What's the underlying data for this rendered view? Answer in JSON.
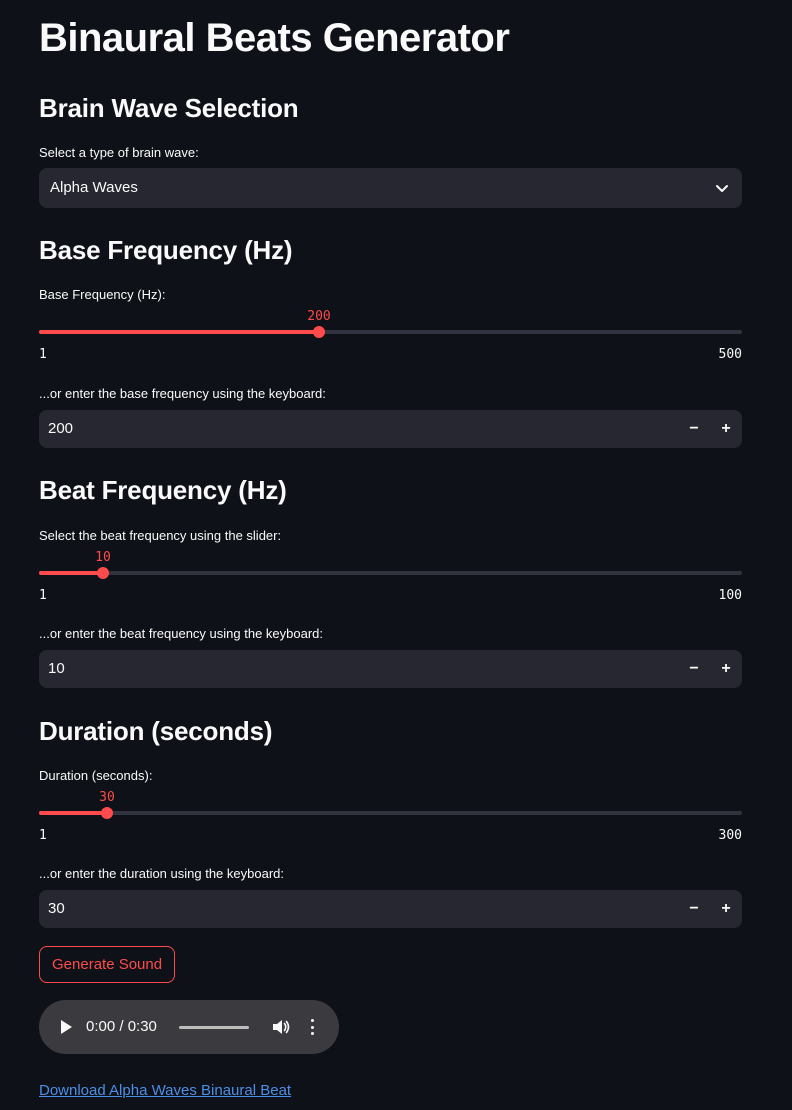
{
  "title": "Binaural Beats Generator",
  "brain_wave": {
    "heading": "Brain Wave Selection",
    "label": "Select a type of brain wave:",
    "selected": "Alpha Waves"
  },
  "base_frequency": {
    "heading": "Base Frequency (Hz)",
    "slider_label": "Base Frequency (Hz):",
    "slider_value": "200",
    "slider_min": "1",
    "slider_max": "500",
    "input_label": "...or enter the base frequency using the keyboard:",
    "input_value": "200"
  },
  "beat_frequency": {
    "heading": "Beat Frequency (Hz)",
    "slider_label": "Select the beat frequency using the slider:",
    "slider_value": "10",
    "slider_min": "1",
    "slider_max": "100",
    "input_label": "...or enter the beat frequency using the keyboard:",
    "input_value": "10"
  },
  "duration": {
    "heading": "Duration (seconds)",
    "slider_label": "Duration (seconds):",
    "slider_value": "30",
    "slider_min": "1",
    "slider_max": "300",
    "input_label": "...or enter the duration using the keyboard:",
    "input_value": "30"
  },
  "steppers": {
    "minus": "−",
    "plus": "+"
  },
  "generate_button": "Generate Sound",
  "audio_player": {
    "time": "0:00 / 0:30"
  },
  "download_link": "Download Alpha Waves Binaural Beat",
  "colors": {
    "background": "#0e1117",
    "accent": "#ff4b4b",
    "input_bg": "#262730",
    "link": "#4d8ee8"
  },
  "icons": {
    "select": "chevron-down-icon",
    "play": "play-icon",
    "volume": "volume-icon",
    "more": "more-vertical-icon"
  }
}
